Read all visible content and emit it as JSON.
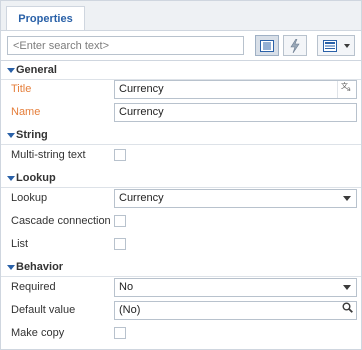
{
  "tabs": [
    {
      "label": "Properties"
    }
  ],
  "search": {
    "placeholder": "<Enter search text>"
  },
  "toolbar": {
    "list_view_icon": "list-view-icon",
    "lightning_icon": "lightning-icon",
    "layout_menu_icon": "layout-menu-icon"
  },
  "sections": {
    "general": {
      "title": "General",
      "title_label": "Title",
      "title_value": "Currency",
      "name_label": "Name",
      "name_value": "Currency"
    },
    "string": {
      "title": "String",
      "multistring_label": "Multi-string text",
      "multistring_checked": false
    },
    "lookup": {
      "title": "Lookup",
      "lookup_label": "Lookup",
      "lookup_value": "Currency",
      "cascade_label": "Cascade connection",
      "cascade_checked": false,
      "list_label": "List",
      "list_checked": false
    },
    "behavior": {
      "title": "Behavior",
      "required_label": "Required",
      "required_value": "No",
      "default_label": "Default value",
      "default_value": "(No)",
      "makecopy_label": "Make copy",
      "makecopy_checked": false
    }
  },
  "colors": {
    "accent": "#2a61a8",
    "required_label": "#e57e3a",
    "border": "#cfd6df"
  }
}
